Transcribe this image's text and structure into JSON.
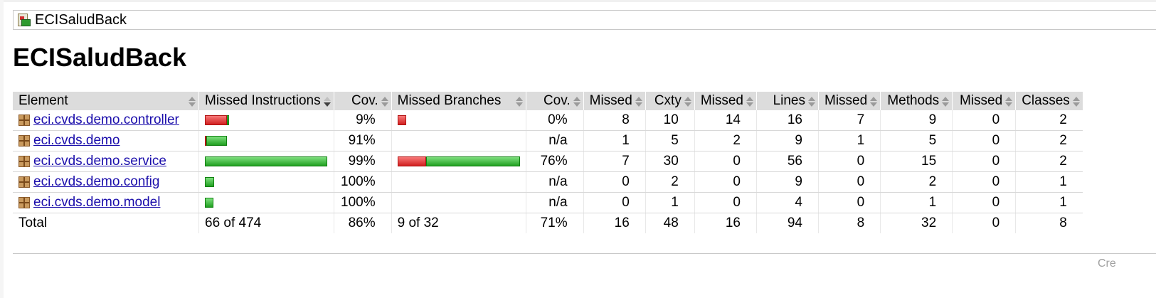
{
  "breadcrumb": {
    "label": "ECISaludBack"
  },
  "page": {
    "title": "ECISaludBack"
  },
  "table": {
    "headers": [
      "Element",
      "Missed Instructions",
      "Cov.",
      "Missed Branches",
      "Cov.",
      "Missed",
      "Cxty",
      "Missed",
      "Lines",
      "Missed",
      "Methods",
      "Missed",
      "Classes"
    ],
    "sorted_column": "Missed Instructions",
    "rows": [
      {
        "name": "eci.cvds.demo.controller",
        "instr_cov": "9%",
        "branch_cov": "0%",
        "missed_cxty": "8",
        "cxty": "10",
        "missed_lines": "14",
        "lines": "16",
        "missed_methods": "7",
        "methods": "9",
        "missed_classes": "0",
        "classes": "2",
        "instr_bar": {
          "missed_fraction": 0.183,
          "covered_fraction": 0.017
        },
        "branch_bar": {
          "missed_fraction": 0.07,
          "covered_fraction": 0
        }
      },
      {
        "name": "eci.cvds.demo",
        "instr_cov": "91%",
        "branch_cov": "n/a",
        "missed_cxty": "1",
        "cxty": "5",
        "missed_lines": "2",
        "lines": "9",
        "missed_methods": "1",
        "methods": "5",
        "missed_classes": "0",
        "classes": "2",
        "instr_bar": {
          "missed_fraction": 0.01,
          "covered_fraction": 0.17
        },
        "branch_bar": null
      },
      {
        "name": "eci.cvds.demo.service",
        "instr_cov": "99%",
        "branch_cov": "76%",
        "missed_cxty": "7",
        "cxty": "30",
        "missed_lines": "0",
        "lines": "56",
        "missed_methods": "0",
        "methods": "15",
        "missed_classes": "0",
        "classes": "2",
        "instr_bar": {
          "missed_fraction": 0.0,
          "covered_fraction": 1.0
        },
        "branch_bar": {
          "missed_fraction": 0.23,
          "covered_fraction": 0.77
        }
      },
      {
        "name": "eci.cvds.demo.config",
        "instr_cov": "100%",
        "branch_cov": "n/a",
        "missed_cxty": "0",
        "cxty": "2",
        "missed_lines": "0",
        "lines": "9",
        "missed_methods": "0",
        "methods": "2",
        "missed_classes": "0",
        "classes": "1",
        "instr_bar": {
          "missed_fraction": 0,
          "covered_fraction": 0.075
        },
        "branch_bar": null
      },
      {
        "name": "eci.cvds.demo.model",
        "instr_cov": "100%",
        "branch_cov": "n/a",
        "missed_cxty": "0",
        "cxty": "1",
        "missed_lines": "0",
        "lines": "4",
        "missed_methods": "0",
        "methods": "1",
        "missed_classes": "0",
        "classes": "1",
        "instr_bar": {
          "missed_fraction": 0,
          "covered_fraction": 0.07
        },
        "branch_bar": null
      }
    ],
    "total": {
      "label": "Total",
      "instr": "66 of 474",
      "instr_cov": "86%",
      "branch": "9 of 32",
      "branch_cov": "71%",
      "missed_cxty": "16",
      "cxty": "48",
      "missed_lines": "16",
      "lines": "94",
      "missed_methods": "8",
      "methods": "32",
      "missed_classes": "0",
      "classes": "8"
    }
  },
  "footer": {
    "text": "Cre"
  },
  "colors": {
    "missed": "#d02020",
    "covered": "#20a020",
    "header_bg": "#dcdcdc",
    "link": "#1a0dab"
  }
}
